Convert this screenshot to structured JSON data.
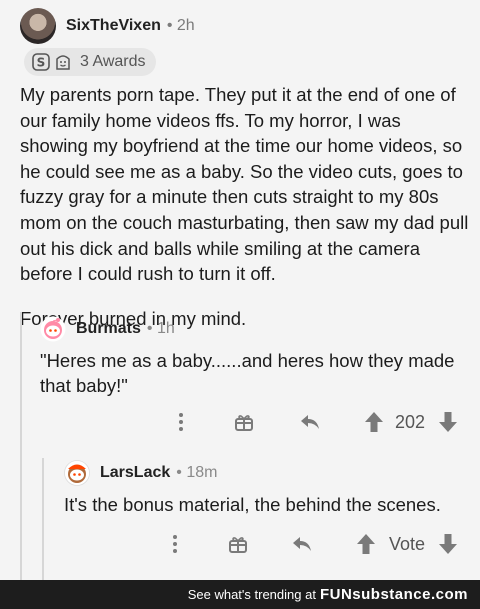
{
  "post": {
    "username": "SixTheVixen",
    "time": "• 2h",
    "awards_label": "3 Awards",
    "paragraphs": [
      "My parents porn tape. They put it at the end of one of our family home videos ffs. To my horror, I was showing my boyfriend at the time our home videos, so he could see me as a baby. So the video cuts, goes to fuzzy gray for a minute then cuts straight to my 80s mom on the couch masturbating, then saw my dad pull out his dick and balls while smiling at the camera before I could rush to turn it off.",
      "Forever burned in my mind."
    ]
  },
  "reply1": {
    "username": "Burmats",
    "time": "• 1h",
    "text": "\"Heres me as a baby......and heres how they made that baby!\"",
    "vote_count": "202"
  },
  "reply2": {
    "username": "LarsLack",
    "time": "• 18m",
    "text": "It's the bonus material, the behind the scenes.",
    "vote_label": "Vote"
  },
  "footer": {
    "text": "See what's trending at",
    "brand_fun": "FUN",
    "brand_rest": "substance.com"
  },
  "colors": {
    "background": "#f4f4f4",
    "footer_bg": "#1d1d1d",
    "snoo_red": "#ff4500",
    "icon_gray": "#7a7a7a"
  }
}
